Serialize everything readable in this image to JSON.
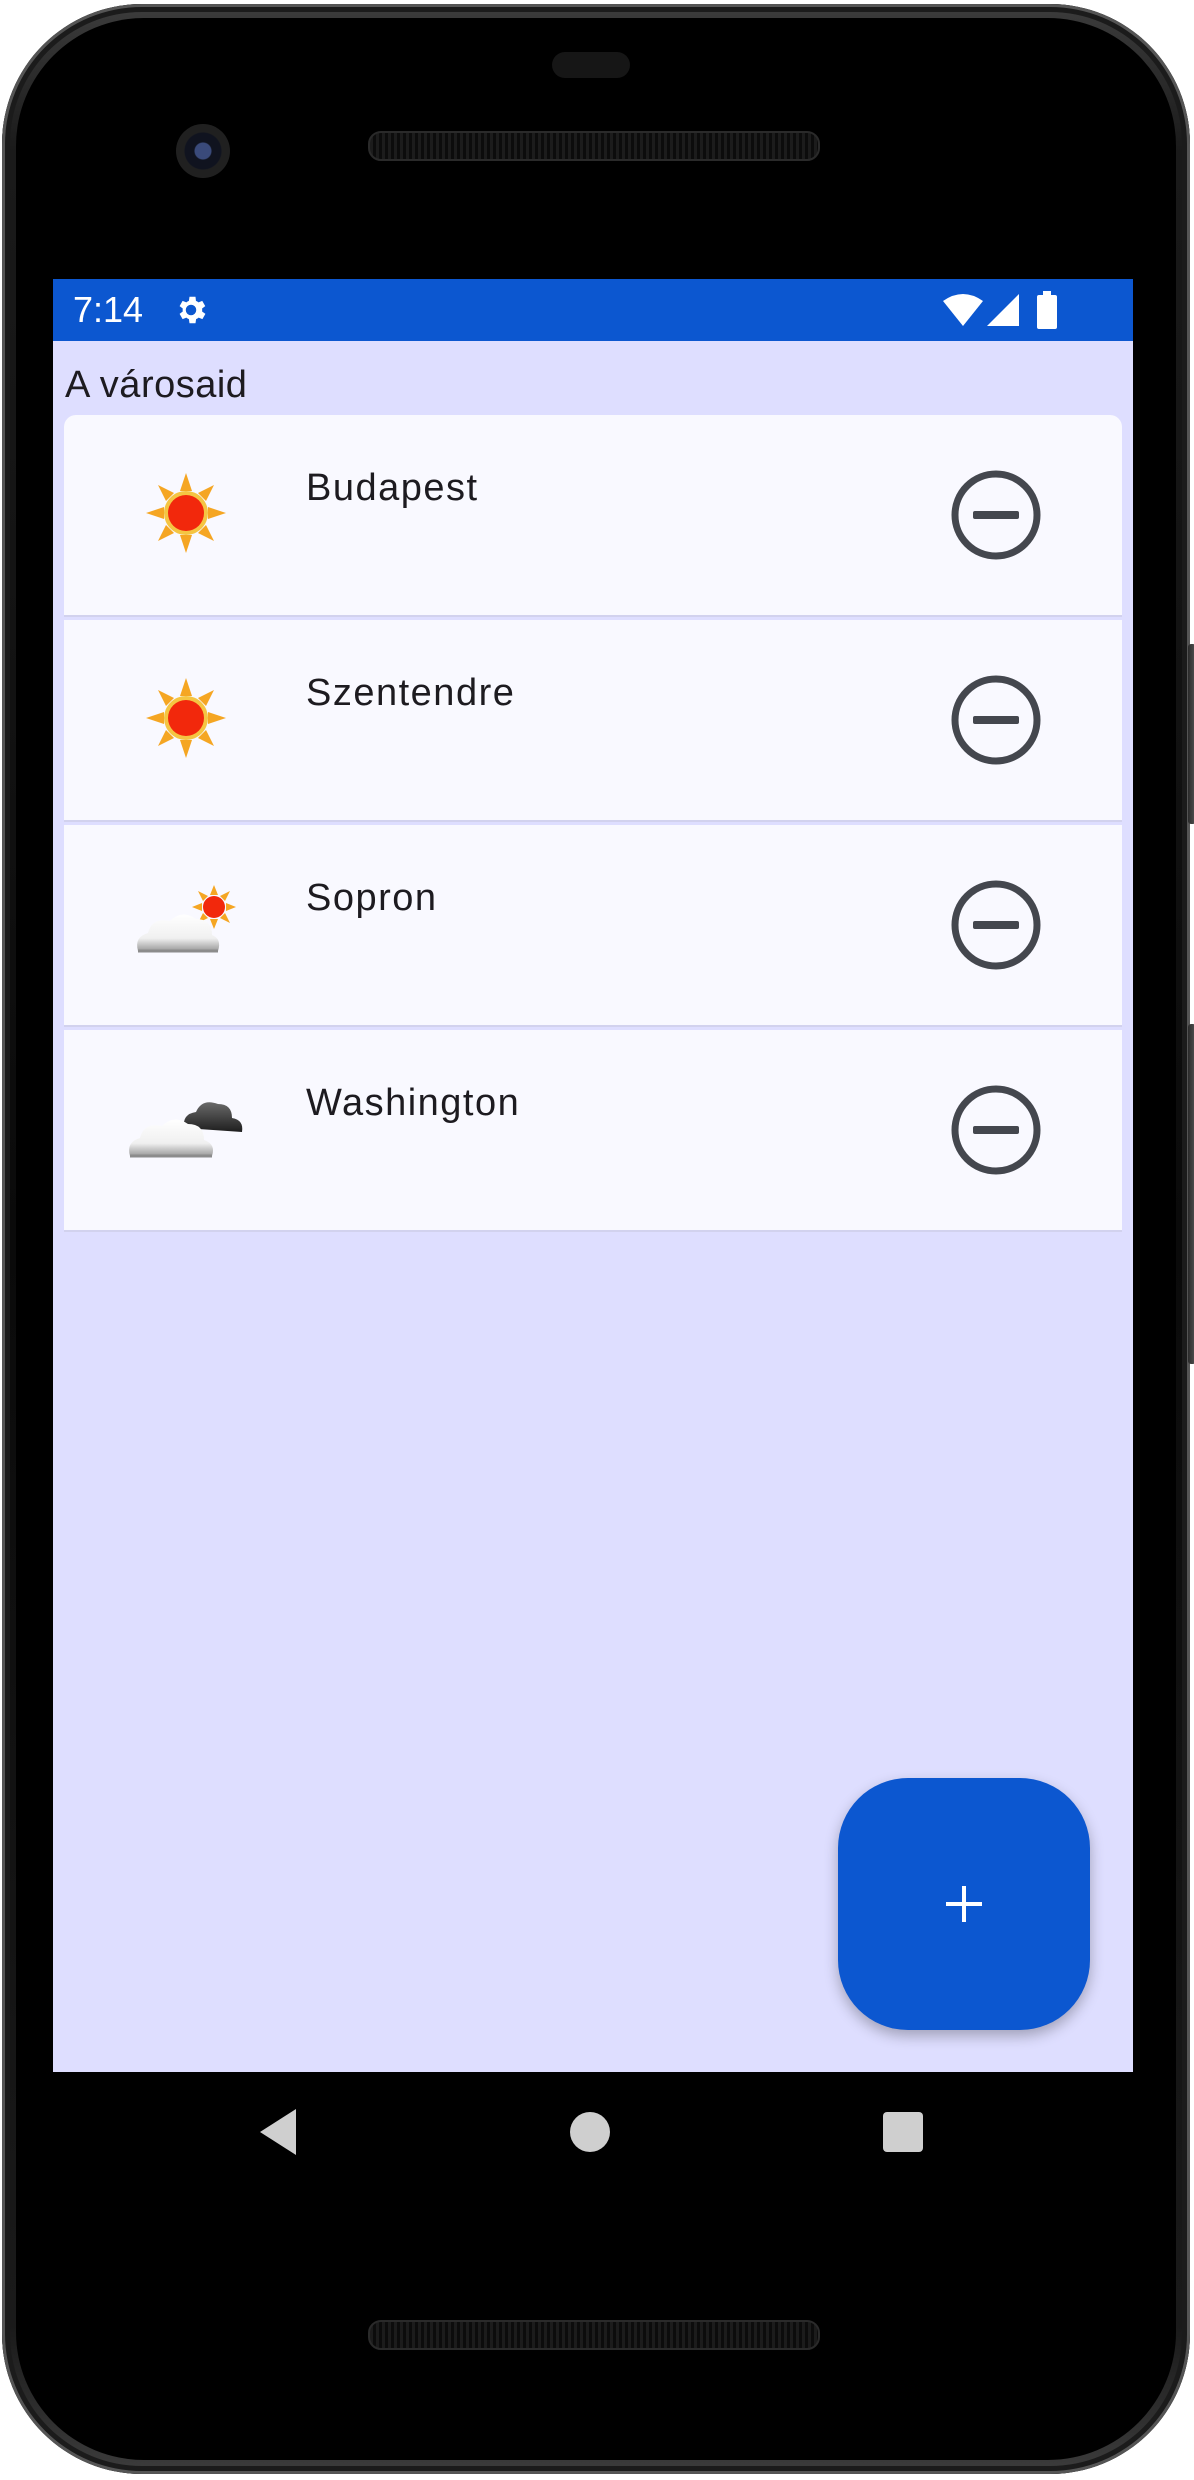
{
  "status_bar": {
    "time": "7:14",
    "icons": [
      "gear-icon",
      "wifi-icon",
      "signal-icon",
      "battery-icon"
    ],
    "background": "#0c57d0"
  },
  "page": {
    "title": "A városaid",
    "background": "#dedeff"
  },
  "cities": [
    {
      "name": "Budapest",
      "weather_icon": "sunny-icon",
      "remove_icon": "remove-circle-icon"
    },
    {
      "name": "Szentendre",
      "weather_icon": "sunny-icon",
      "remove_icon": "remove-circle-icon"
    },
    {
      "name": "Sopron",
      "weather_icon": "partly-cloudy-icon",
      "remove_icon": "remove-circle-icon"
    },
    {
      "name": "Washington",
      "weather_icon": "cloudy-icon",
      "remove_icon": "remove-circle-icon"
    }
  ],
  "fab": {
    "icon": "plus-icon",
    "label": "+",
    "color": "#0c57d0"
  },
  "nav_bar": {
    "icons": [
      "back-icon",
      "home-icon",
      "recents-icon"
    ]
  }
}
